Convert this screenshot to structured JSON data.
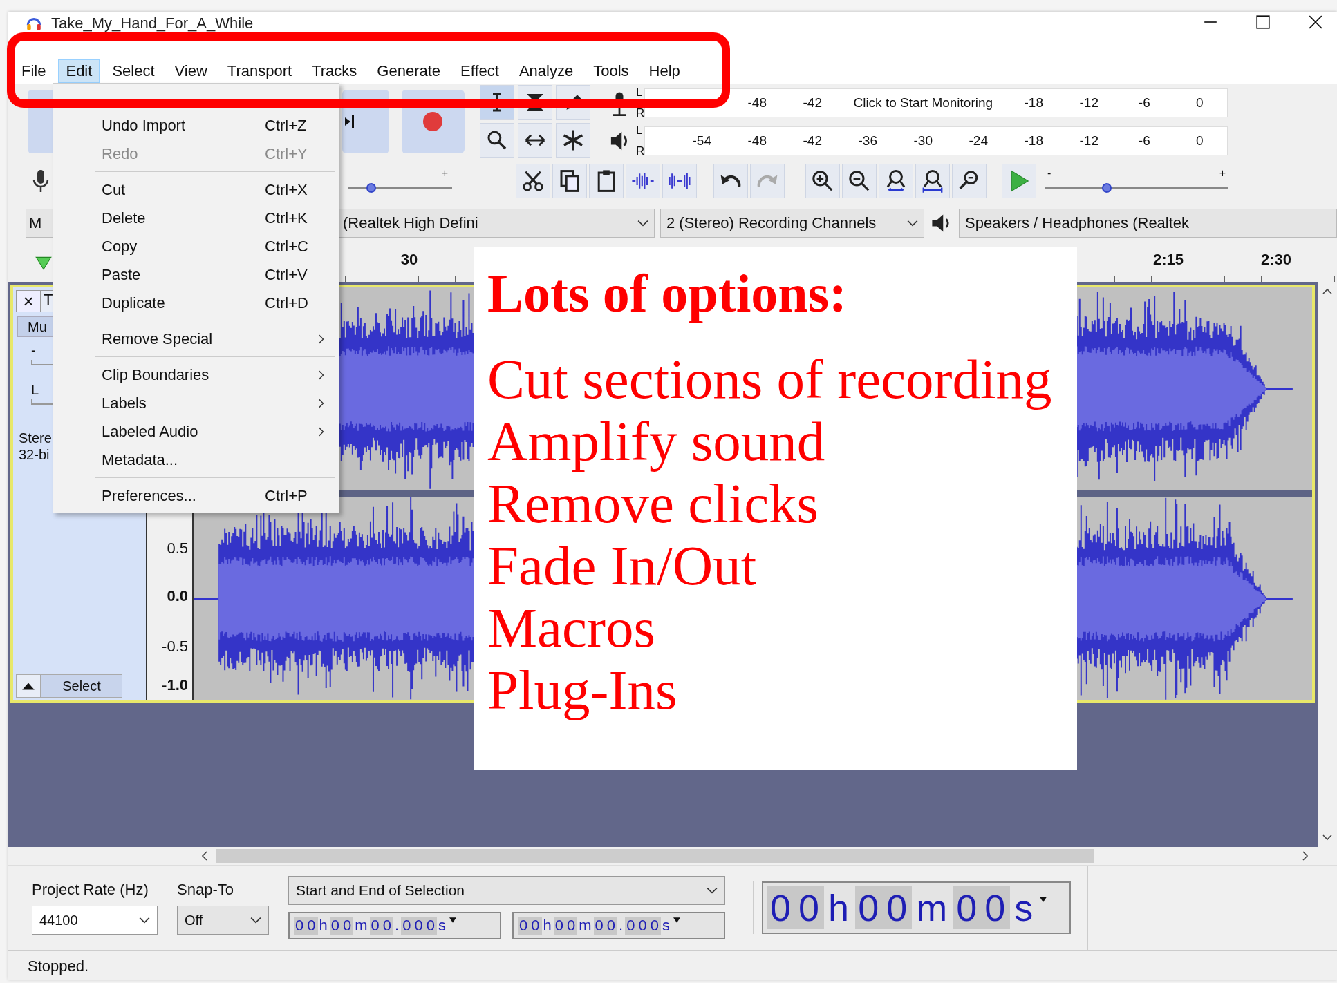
{
  "window": {
    "title": "Take_My_Hand_For_A_While"
  },
  "menu_bar": [
    {
      "label": "File",
      "selected": false
    },
    {
      "label": "Edit",
      "selected": true
    },
    {
      "label": "Select",
      "selected": false
    },
    {
      "label": "View",
      "selected": false
    },
    {
      "label": "Transport",
      "selected": false
    },
    {
      "label": "Tracks",
      "selected": false
    },
    {
      "label": "Generate",
      "selected": false
    },
    {
      "label": "Effect",
      "selected": false
    },
    {
      "label": "Analyze",
      "selected": false
    },
    {
      "label": "Tools",
      "selected": false
    },
    {
      "label": "Help",
      "selected": false
    }
  ],
  "edit_menu": [
    {
      "kind": "command",
      "label": "Undo Import",
      "shortcut": "Ctrl+Z",
      "disabled": false
    },
    {
      "kind": "command",
      "label": "Redo",
      "shortcut": "Ctrl+Y",
      "disabled": true
    },
    {
      "kind": "separator"
    },
    {
      "kind": "command",
      "label": "Cut",
      "shortcut": "Ctrl+X",
      "disabled": false
    },
    {
      "kind": "command",
      "label": "Delete",
      "shortcut": "Ctrl+K",
      "disabled": false
    },
    {
      "kind": "command",
      "label": "Copy",
      "shortcut": "Ctrl+C",
      "disabled": false
    },
    {
      "kind": "command",
      "label": "Paste",
      "shortcut": "Ctrl+V",
      "disabled": false
    },
    {
      "kind": "command",
      "label": "Duplicate",
      "shortcut": "Ctrl+D",
      "disabled": false
    },
    {
      "kind": "separator"
    },
    {
      "kind": "submenu",
      "label": "Remove Special",
      "disabled": false
    },
    {
      "kind": "separator"
    },
    {
      "kind": "submenu",
      "label": "Clip Boundaries",
      "disabled": false
    },
    {
      "kind": "submenu",
      "label": "Labels",
      "disabled": false
    },
    {
      "kind": "submenu",
      "label": "Labeled Audio",
      "disabled": false
    },
    {
      "kind": "command",
      "label": "Metadata...",
      "disabled": false
    },
    {
      "kind": "separator"
    },
    {
      "kind": "command",
      "label": "Preferences...",
      "shortcut": "Ctrl+P",
      "disabled": false
    }
  ],
  "meters": {
    "recording": {
      "channels": [
        "L",
        "R"
      ],
      "scale": [
        {
          "kind": "tick",
          "label": "-48"
        },
        {
          "kind": "tick",
          "label": "-42"
        },
        {
          "kind": "prompt",
          "label": "Click to Start Monitoring"
        },
        {
          "kind": "tick",
          "label": "-18"
        },
        {
          "kind": "tick",
          "label": "-12"
        },
        {
          "kind": "tick",
          "label": "-6"
        },
        {
          "kind": "tick",
          "label": "0"
        }
      ]
    },
    "playback": {
      "channels": [
        "L",
        "R"
      ],
      "scale": [
        {
          "kind": "tick",
          "label": "-54"
        },
        {
          "kind": "tick",
          "label": "-48"
        },
        {
          "kind": "tick",
          "label": "-42"
        },
        {
          "kind": "tick",
          "label": "-36"
        },
        {
          "kind": "tick",
          "label": "-30"
        },
        {
          "kind": "tick",
          "label": "-24"
        },
        {
          "kind": "tick",
          "label": "-18"
        },
        {
          "kind": "tick",
          "label": "-12"
        },
        {
          "kind": "tick",
          "label": "-6"
        },
        {
          "kind": "tick",
          "label": "0"
        }
      ]
    }
  },
  "recording_volume": {
    "plus": "+",
    "level": 0.22
  },
  "playback_speed": {
    "minus": "-",
    "plus": "+",
    "level": 0.34
  },
  "devices": {
    "host": "M",
    "recording_device": "(Realtek High Defini",
    "recording_channels": "2 (Stereo) Recording Channels",
    "playback_device": "Speakers / Headphones (Realtek"
  },
  "ruler": [
    "30",
    "2:15",
    "2:30"
  ],
  "track": {
    "close": "×",
    "name": "T",
    "mute": "Mu",
    "gain": "-",
    "pan": "L",
    "info": [
      "Stere",
      "32-bi"
    ],
    "select": "Select",
    "scale": [
      "0.5",
      "0.0",
      "-0.5",
      "-1.0"
    ]
  },
  "selection_toolbar": {
    "project_rate_label": "Project Rate (Hz)",
    "project_rate": "44100",
    "snap_to_label": "Snap-To",
    "snap_to": "Off",
    "selection_mode": "Start and End of Selection",
    "start": "00h00m00.000s",
    "end": "00h00m00.000s"
  },
  "audio_position": "00h00m00s",
  "status_bar": "Stopped.",
  "annotation": {
    "title": "Lots of options:",
    "lines": [
      "Cut sections of recording",
      "Amplify sound",
      "Remove clicks",
      "Fade In/Out",
      "Macros",
      "Plug-Ins"
    ]
  }
}
